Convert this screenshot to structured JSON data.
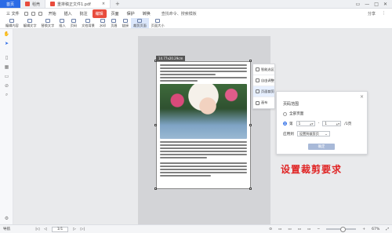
{
  "titlebar": {
    "home_tab": "首页",
    "tabs": [
      "稻壳",
      "重排稿正文件1.pdf"
    ],
    "plus": "+",
    "controls": [
      "▭",
      "—",
      "□",
      "✕"
    ]
  },
  "menu": {
    "file": "三 文件",
    "items": [
      "开始",
      "插入",
      "批注",
      "编辑",
      "页面",
      "保护",
      "转换"
    ],
    "active_index": 3,
    "search": "查找命令、搜索模板",
    "right": [
      "分享",
      "⋮"
    ]
  },
  "toolbar": {
    "items": [
      "编辑内容",
      "编辑文字",
      "替换文字",
      "插入",
      "页码",
      "文档背景",
      "水印",
      "页眉",
      "链接",
      "裁剪页面",
      "页面大小"
    ],
    "active_label": "裁剪页面"
  },
  "leftrail": {
    "labels": [
      "手型",
      "选择"
    ]
  },
  "crop": {
    "size_label": "14.77x20.29cm"
  },
  "side_tools": {
    "items": [
      "智能选区",
      "自由调整",
      "页面裁剪",
      "画布"
    ],
    "active_index": 2
  },
  "panel": {
    "title": "页码范围",
    "all_pages": "全部页面",
    "page_prefix": "第",
    "page_from": "1",
    "page_sep": "-",
    "page_to": "1",
    "page_suffix": "/1页",
    "apply_label": "应用到",
    "apply_value": "设置到裁剪页",
    "confirm": "确定"
  },
  "annotation": "设置裁剪要求",
  "status": {
    "nav": "导航",
    "page_value": "1/1",
    "zoom": "67%",
    "icons": [
      "⊙",
      "▭",
      "▭",
      "▭",
      "▭"
    ]
  },
  "colors": {
    "accent": "#2b6be6",
    "active_menu": "#e84c3d",
    "annotation": "#e02323"
  }
}
